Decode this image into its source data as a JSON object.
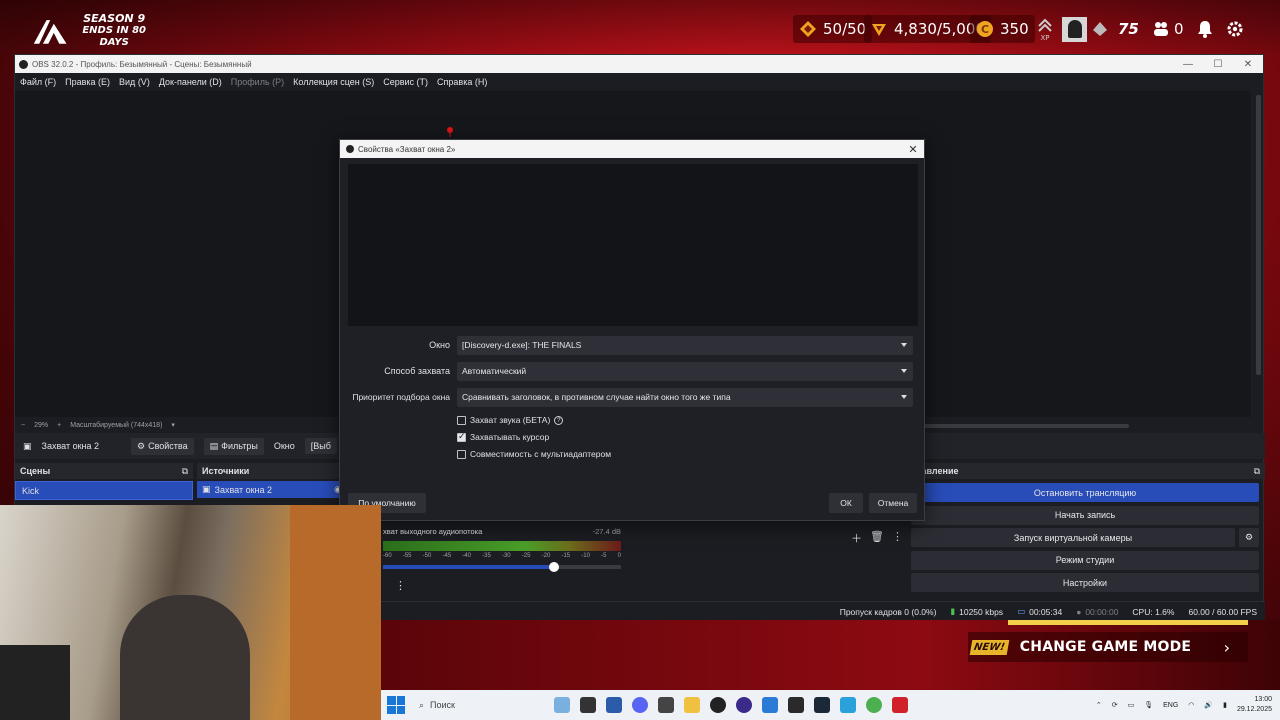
{
  "game": {
    "season_title": "SEASON 9",
    "season_subtitle": "ENDS IN 80 DAYS",
    "hud": {
      "tokens": "50/50",
      "vrs": "4,830/5,000",
      "coins": "350",
      "xp_label": "XP",
      "level": "75",
      "friends": "0"
    },
    "banner": {
      "badge": "NEW!",
      "text": "CHANGE GAME MODE",
      "arrow": "›"
    }
  },
  "obs": {
    "title": "OBS 32.0.2 - Профиль: Безымянный - Сцены: Безымянный",
    "menu": [
      {
        "label": "Файл (F)",
        "disabled": false
      },
      {
        "label": "Правка (E)",
        "disabled": false
      },
      {
        "label": "Вид (V)",
        "disabled": false
      },
      {
        "label": "Док-панели (D)",
        "disabled": false
      },
      {
        "label": "Профиль (P)",
        "disabled": true
      },
      {
        "label": "Коллекция сцен (S)",
        "disabled": false
      },
      {
        "label": "Сервис (T)",
        "disabled": false
      },
      {
        "label": "Справка (H)",
        "disabled": false
      }
    ],
    "zoom": {
      "minus": "−",
      "percent": "29%",
      "plus": "+",
      "mode": "Масштабируемый (744x418)"
    },
    "source_toolbar": {
      "source_name": "Захват окна 2",
      "properties": "Свойства",
      "filters": "Фильтры",
      "window": "Окно",
      "window_value": "[Выб"
    },
    "docks": {
      "scenes": "Сцены",
      "sources": "Источники",
      "controls": "равление"
    },
    "scenes": [
      "Kick"
    ],
    "sources": [
      "Захват окна 2"
    ],
    "audio": {
      "name": "хват выходного аудиопотока",
      "level": "-27.4 dB",
      "ticks": [
        "-60",
        "-55",
        "-50",
        "-45",
        "-40",
        "-35",
        "-30",
        "-25",
        "-20",
        "-15",
        "-10",
        "-5",
        "0"
      ],
      "volume": 0.72
    },
    "controls": {
      "stop_stream": "Остановить трансляцию",
      "start_record": "Начать запись",
      "virtual_cam": "Запуск виртуальной камеры",
      "studio_mode": "Режим студии",
      "settings": "Настройки"
    },
    "status": {
      "dropped": "Пропуск кадров 0 (0.0%)",
      "bitrate": "10250 kbps",
      "stream_time": "00:05:34",
      "record_time": "00:00:00",
      "cpu": "CPU: 1.6%",
      "fps": "60.00 / 60.00 FPS"
    }
  },
  "dialog": {
    "title": "Свойства «Захват окна 2»",
    "fields": {
      "window_label": "Окно",
      "window_value": "[Discovery-d.exe]: THE FINALS",
      "capture_label": "Способ захвата",
      "capture_value": "Автоматический",
      "priority_label": "Приоритет подбора окна",
      "priority_value": "Сравнивать заголовок, в противном случае найти окно того же типа"
    },
    "checks": {
      "audio": "Захват звука (БЕТА)",
      "audio_checked": false,
      "cursor": "Захватывать курсор",
      "cursor_checked": true,
      "multiadapter": "Совместимость с мультиадаптером",
      "multiadapter_checked": false
    },
    "buttons": {
      "defaults": "По умолчанию",
      "ok": "ОК",
      "cancel": "Отмена"
    }
  },
  "taskbar": {
    "search": "Поиск",
    "lang": "ENG",
    "time": "13:00",
    "date": "29.12.2025"
  }
}
